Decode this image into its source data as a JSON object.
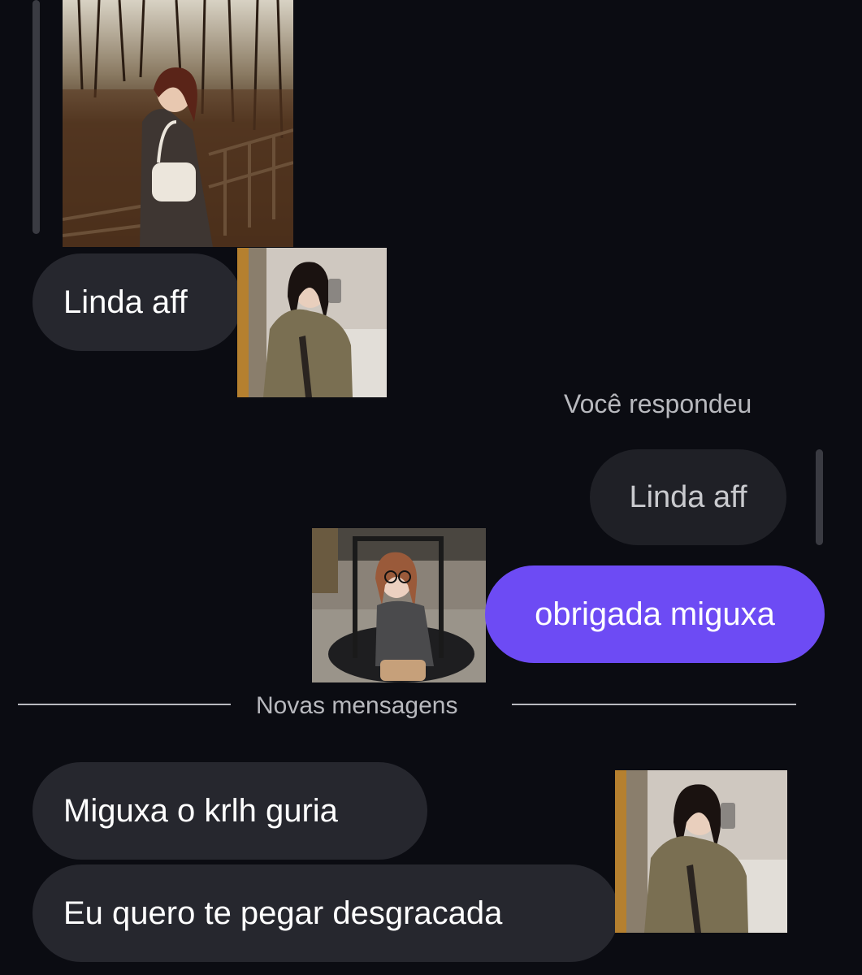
{
  "messages": {
    "received_1": "Linda aff",
    "reply_caption": "Você respondeu",
    "quoted": "Linda aff",
    "sent_1": "obrigada miguxa",
    "received_2": "Miguxa o krlh guria",
    "received_3": "Eu quero te pegar desgracada"
  },
  "divider": {
    "label": "Novas mensagens"
  },
  "colors": {
    "background": "#0b0c12",
    "received_bubble": "#26272e",
    "sent_bubble": "#6d4bf4",
    "quoted_bubble": "#1f2026"
  }
}
